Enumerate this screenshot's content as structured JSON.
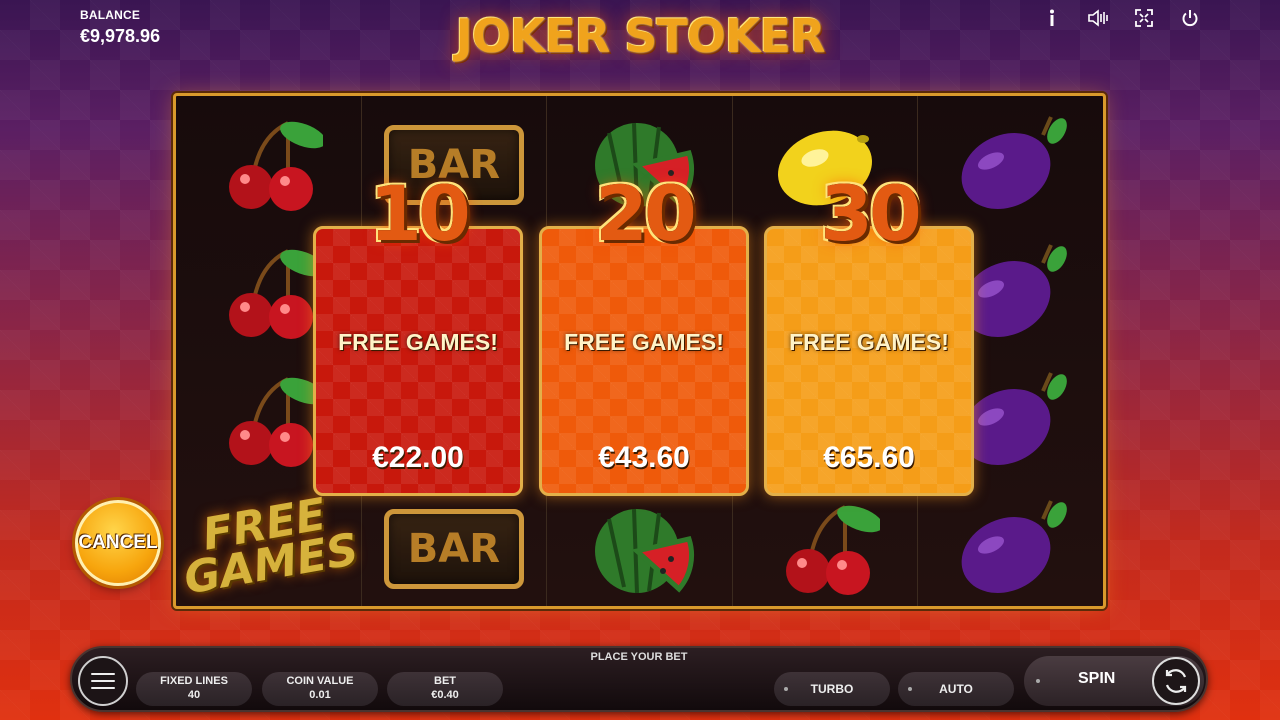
{
  "header": {
    "balance_label": "BALANCE",
    "balance_value": "€9,978.96",
    "logo_text": "JOKER STOKER",
    "icons": [
      "info-icon",
      "sound-icon",
      "fullscreen-icon",
      "power-icon"
    ]
  },
  "reels": {
    "columns": [
      [
        "cherry",
        "cherry",
        "cherry",
        "free-games"
      ],
      [
        "bar",
        "bar"
      ],
      [
        "watermelon",
        "watermelon"
      ],
      [
        "lemon",
        "cherry"
      ],
      [
        "plum",
        "plum",
        "plum",
        "plum"
      ]
    ],
    "free_games_symbol_line1": "FREE",
    "free_games_symbol_line2": "GAMES",
    "bar_symbol_text": "BAR"
  },
  "offers": [
    {
      "count": "10",
      "title": "FREE GAMES!",
      "price": "€22.00",
      "color": "#c8180c"
    },
    {
      "count": "20",
      "title": "FREE GAMES!",
      "price": "€43.60",
      "color": "#ef5a0a"
    },
    {
      "count": "30",
      "title": "FREE GAMES!",
      "price": "€65.60",
      "color": "#f59d18"
    }
  ],
  "cancel_label": "CANCEL",
  "panel": {
    "place_bet": "PLACE YOUR BET",
    "fixed_lines_label": "FIXED LINES",
    "fixed_lines_value": "40",
    "coin_value_label": "COIN VALUE",
    "coin_value_value": "0.01",
    "bet_label": "BET",
    "bet_value": "€0.40",
    "turbo_label": "TURBO",
    "auto_label": "AUTO",
    "spin_label": "SPIN"
  },
  "colors": {
    "frame_gold": "#d99a2c",
    "accent_orange": "#f7a50d"
  }
}
